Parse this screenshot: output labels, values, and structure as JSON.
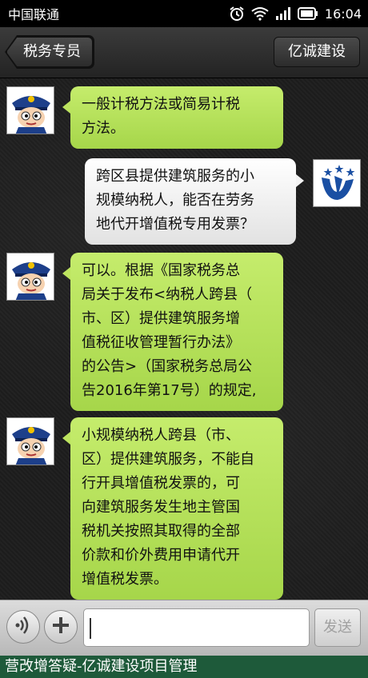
{
  "status_bar": {
    "carrier": "中国联通",
    "time": "16:04",
    "icons": [
      "alarm-icon",
      "wifi-icon",
      "signal-icon",
      "battery-icon"
    ]
  },
  "header": {
    "back_label": "税务专员",
    "right_label": "亿诚建设"
  },
  "messages": [
    {
      "side": "left",
      "sender": "税务专员",
      "avatar": "tax-officer-avatar",
      "text": "一般计税方法或简易计税\n方法。"
    },
    {
      "side": "right",
      "sender": "亿诚建设",
      "avatar": "company-logo-avatar",
      "text": "跨区县提供建筑服务的小\n规模纳税人，能否在劳务\n地代开增值税专用发票？"
    },
    {
      "side": "left",
      "sender": "税务专员",
      "avatar": "tax-officer-avatar",
      "text": "可以。根据《国家税务总\n局关于发布<纳税人跨县（\n市、区）提供建筑服务增\n值税征收管理暂行办法》\n的公告>（国家税务总局公\n告2016年第17号）的规定,"
    },
    {
      "side": "left",
      "sender": "税务专员",
      "avatar": "tax-officer-avatar",
      "text": "小规模纳税人跨县（市、\n区）提供建筑服务，不能自\n行开具增值税发票的，可\n向建筑服务发生地主管国\n税机关按照其取得的全部\n价款和价外费用申请代开\n增值税发票。"
    }
  ],
  "input_bar": {
    "voice_icon": "voice-icon",
    "plus_icon": "plus-icon",
    "input_value": "",
    "send_label": "发送"
  },
  "footer": {
    "text": "营改增答疑-亿诚建设项目管理"
  },
  "colors": {
    "left_bubble": "#b5e05a",
    "right_bubble": "#f2f2f2",
    "footer_bg": "#1e5a3a"
  }
}
